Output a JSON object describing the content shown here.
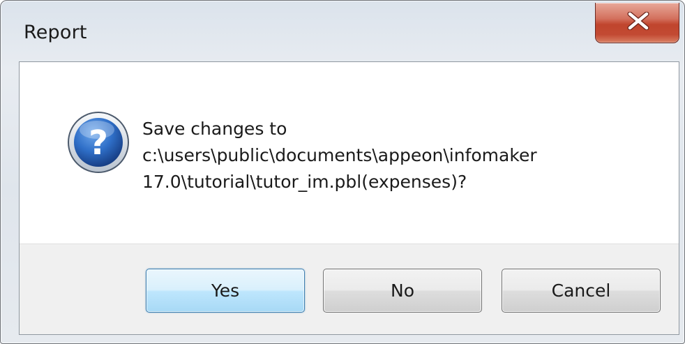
{
  "window": {
    "title": "Report"
  },
  "dialog": {
    "icon": "question-icon",
    "message_lines": [
      "Save changes to",
      "c:\\users\\public\\documents\\appeon\\infomaker",
      "17.0\\tutorial\\tutor_im.pbl(expenses)?"
    ]
  },
  "buttons": {
    "yes": "Yes",
    "no": "No",
    "cancel": "Cancel"
  },
  "colors": {
    "close_button": "#c94a33",
    "default_button_border": "#3c7fb1",
    "icon_blue": "#2a5fb0"
  }
}
